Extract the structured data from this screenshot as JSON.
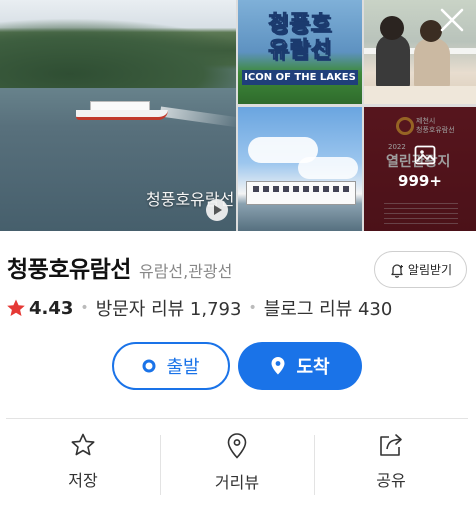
{
  "gallery": {
    "main_caption": "청풍호유람선",
    "logo_line1": "청풍호",
    "logo_line2": "유람선",
    "logo_subtitle": "ICON OF THE LAKES",
    "board_small_1": "제천시",
    "board_small_2": "청풍호유람선",
    "board_year": "2022",
    "board_title": "열린관광지",
    "more_count": "999+"
  },
  "place": {
    "name": "청풍호유람선",
    "category": "유람선,관광선"
  },
  "alert_button": {
    "label": "알림받기"
  },
  "stats": {
    "rating": "4.43",
    "visitor_reviews": "방문자 리뷰 1,793",
    "blog_reviews": "블로그 리뷰 430"
  },
  "route": {
    "depart_label": "출발",
    "arrive_label": "도착"
  },
  "actions": {
    "save_label": "저장",
    "street_view_label": "거리뷰",
    "share_label": "공유"
  },
  "colors": {
    "accent": "#1a73e8",
    "star": "#e53935",
    "muted_text": "#888888"
  },
  "icons": [
    "close-icon",
    "play-icon",
    "image-icon",
    "bell-icon",
    "star-icon",
    "location-dot-icon",
    "pin-icon",
    "star-outline-icon",
    "map-pin-outline-icon",
    "share-icon"
  ]
}
